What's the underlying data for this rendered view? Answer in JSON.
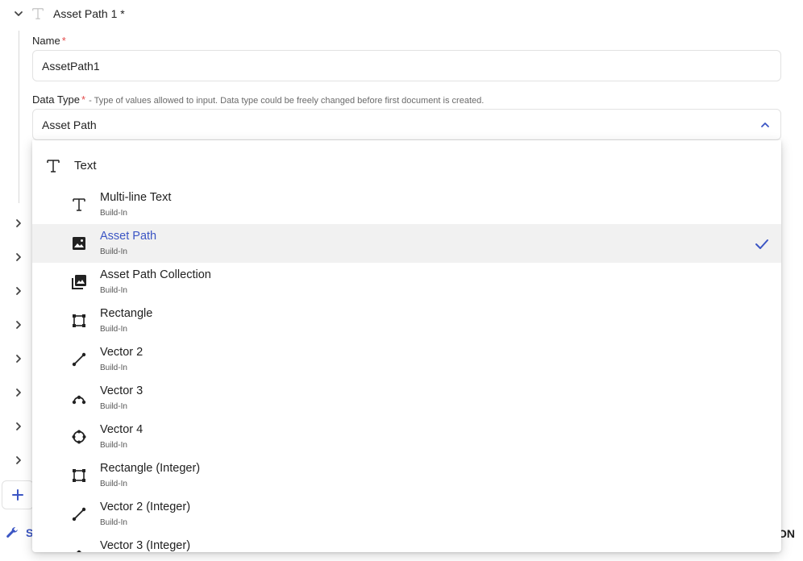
{
  "section": {
    "title": "Asset Path 1 *"
  },
  "name_field": {
    "label": "Name",
    "required_mark": "*",
    "value": "AssetPath1"
  },
  "data_type_field": {
    "label": "Data Type",
    "required_mark": "*",
    "hint": "- Type of values allowed to input. Data type could be freely changed before first document is created.",
    "value": "Asset Path"
  },
  "dropdown": {
    "group_label": "Text",
    "options": [
      {
        "title": "Multi-line Text",
        "subtitle": "Build-In",
        "icon": "text-icon",
        "selected": false
      },
      {
        "title": "Asset Path",
        "subtitle": "Build-In",
        "icon": "image-icon",
        "selected": true
      },
      {
        "title": "Asset Path Collection",
        "subtitle": "Build-In",
        "icon": "image-collection-icon",
        "selected": false
      },
      {
        "title": "Rectangle",
        "subtitle": "Build-In",
        "icon": "rectangle-icon",
        "selected": false
      },
      {
        "title": "Vector 2",
        "subtitle": "Build-In",
        "icon": "line-icon",
        "selected": false
      },
      {
        "title": "Vector 3",
        "subtitle": "Build-In",
        "icon": "curve-icon",
        "selected": false
      },
      {
        "title": "Vector 4",
        "subtitle": "Build-In",
        "icon": "circle-nodes-icon",
        "selected": false
      },
      {
        "title": "Rectangle (Integer)",
        "subtitle": "Build-In",
        "icon": "rectangle-icon",
        "selected": false
      },
      {
        "title": "Vector 2 (Integer)",
        "subtitle": "Build-In",
        "icon": "line-icon",
        "selected": false
      },
      {
        "title": "Vector 3 (Integer)",
        "subtitle": "",
        "icon": "curve-icon",
        "selected": false
      }
    ]
  },
  "footer": {
    "left_label": "S",
    "right_label": "ON"
  },
  "colors": {
    "accent": "#3b55c4",
    "required": "#e34b4b",
    "selected_bg": "#f1f1f1"
  }
}
